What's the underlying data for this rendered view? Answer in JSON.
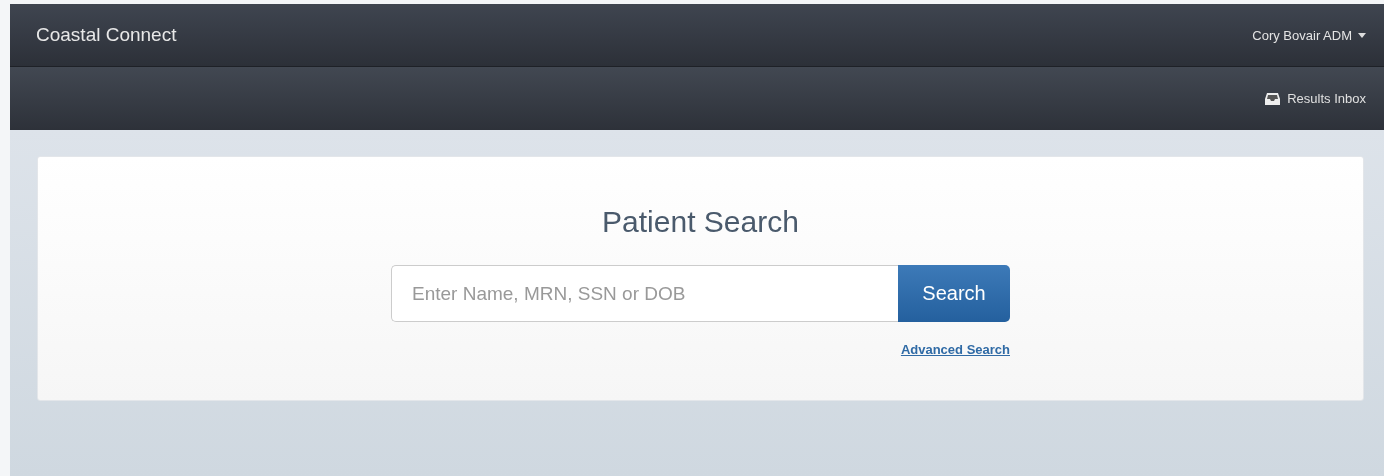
{
  "navbar": {
    "brand": "Coastal Connect",
    "user_menu": "Cory Bovair ADM"
  },
  "subnav": {
    "results_inbox": "Results Inbox"
  },
  "search_panel": {
    "title": "Patient Search",
    "search_field": {
      "placeholder": "Enter Name, MRN, SSN or DOB"
    },
    "search_button": "Search",
    "advanced_link": "Advanced Search"
  }
}
